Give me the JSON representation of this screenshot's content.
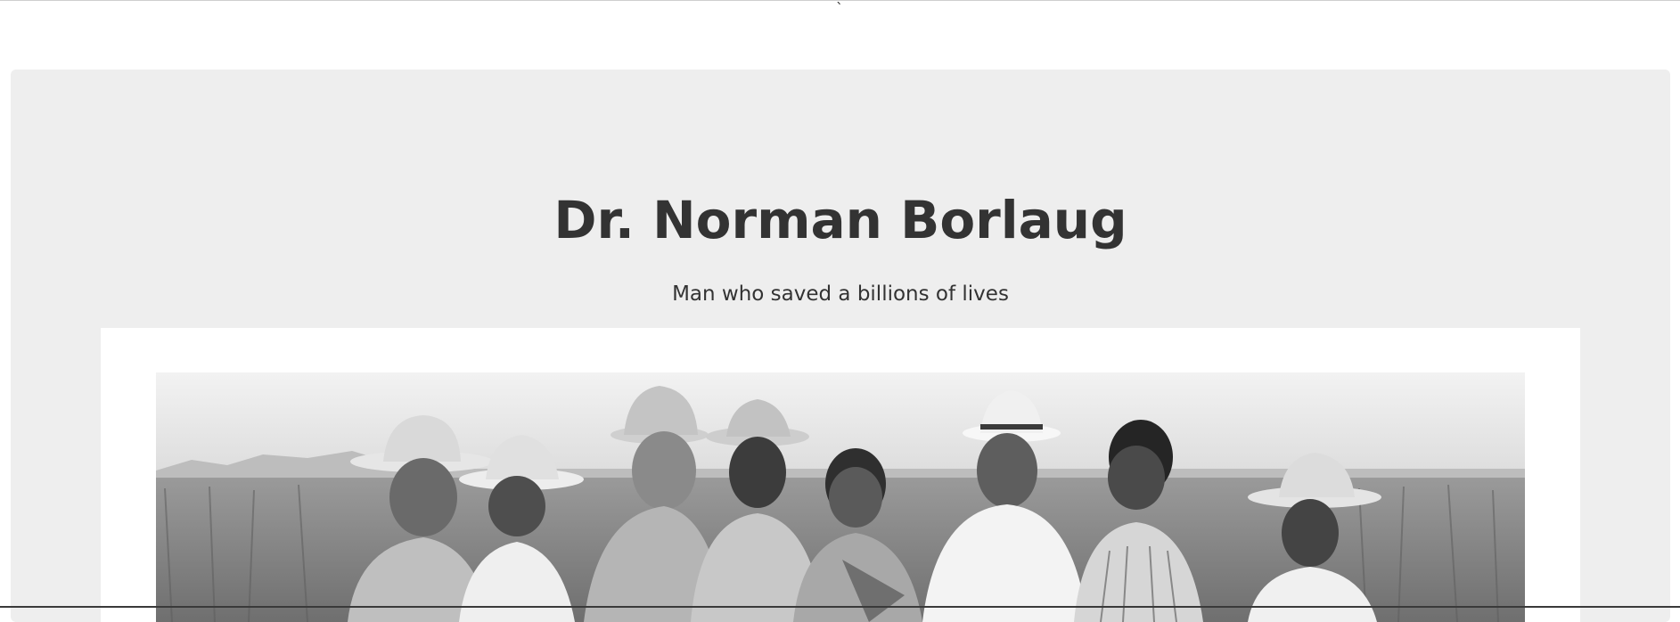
{
  "page": {
    "stray_text": "`"
  },
  "hero": {
    "title": "Dr. Norman Borlaug",
    "subtitle": "Man who saved a billions of lives"
  },
  "image": {
    "subject": "Black-and-white photograph of men in a wheat field wearing hats",
    "style": "grayscale"
  },
  "colors": {
    "jumbotron_bg": "#eeeeee",
    "text": "#333333",
    "page_bg": "#ffffff"
  }
}
